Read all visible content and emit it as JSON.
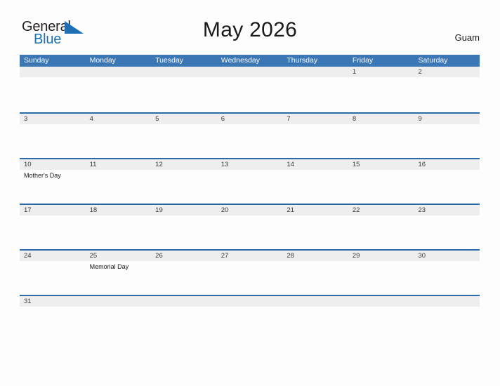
{
  "brand": {
    "word_one": "General",
    "word_two": "Blue",
    "triangle_icon": "triangle-icon",
    "color_dark": "#231f20",
    "color_blue": "#1f6fb5"
  },
  "header": {
    "title": "May 2026",
    "locale": "Guam"
  },
  "theme": {
    "header_blue": "#3b76b5",
    "row_border_blue": "#2a6aa8",
    "date_band_gray": "#eeeeee",
    "page_background": "#fdfdfd"
  },
  "calendar": {
    "weekdays": [
      "Sunday",
      "Monday",
      "Tuesday",
      "Wednesday",
      "Thursday",
      "Friday",
      "Saturday"
    ],
    "weeks": [
      {
        "days": [
          {
            "date": "",
            "event": ""
          },
          {
            "date": "",
            "event": ""
          },
          {
            "date": "",
            "event": ""
          },
          {
            "date": "",
            "event": ""
          },
          {
            "date": "",
            "event": ""
          },
          {
            "date": "1",
            "event": ""
          },
          {
            "date": "2",
            "event": ""
          }
        ]
      },
      {
        "days": [
          {
            "date": "3",
            "event": ""
          },
          {
            "date": "4",
            "event": ""
          },
          {
            "date": "5",
            "event": ""
          },
          {
            "date": "6",
            "event": ""
          },
          {
            "date": "7",
            "event": ""
          },
          {
            "date": "8",
            "event": ""
          },
          {
            "date": "9",
            "event": ""
          }
        ]
      },
      {
        "days": [
          {
            "date": "10",
            "event": "Mother's Day"
          },
          {
            "date": "11",
            "event": ""
          },
          {
            "date": "12",
            "event": ""
          },
          {
            "date": "13",
            "event": ""
          },
          {
            "date": "14",
            "event": ""
          },
          {
            "date": "15",
            "event": ""
          },
          {
            "date": "16",
            "event": ""
          }
        ]
      },
      {
        "days": [
          {
            "date": "17",
            "event": ""
          },
          {
            "date": "18",
            "event": ""
          },
          {
            "date": "19",
            "event": ""
          },
          {
            "date": "20",
            "event": ""
          },
          {
            "date": "21",
            "event": ""
          },
          {
            "date": "22",
            "event": ""
          },
          {
            "date": "23",
            "event": ""
          }
        ]
      },
      {
        "days": [
          {
            "date": "24",
            "event": ""
          },
          {
            "date": "25",
            "event": "Memorial Day"
          },
          {
            "date": "26",
            "event": ""
          },
          {
            "date": "27",
            "event": ""
          },
          {
            "date": "28",
            "event": ""
          },
          {
            "date": "29",
            "event": ""
          },
          {
            "date": "30",
            "event": ""
          }
        ]
      },
      {
        "days": [
          {
            "date": "31",
            "event": ""
          },
          {
            "date": "",
            "event": ""
          },
          {
            "date": "",
            "event": ""
          },
          {
            "date": "",
            "event": ""
          },
          {
            "date": "",
            "event": ""
          },
          {
            "date": "",
            "event": ""
          },
          {
            "date": "",
            "event": ""
          }
        ]
      }
    ]
  }
}
